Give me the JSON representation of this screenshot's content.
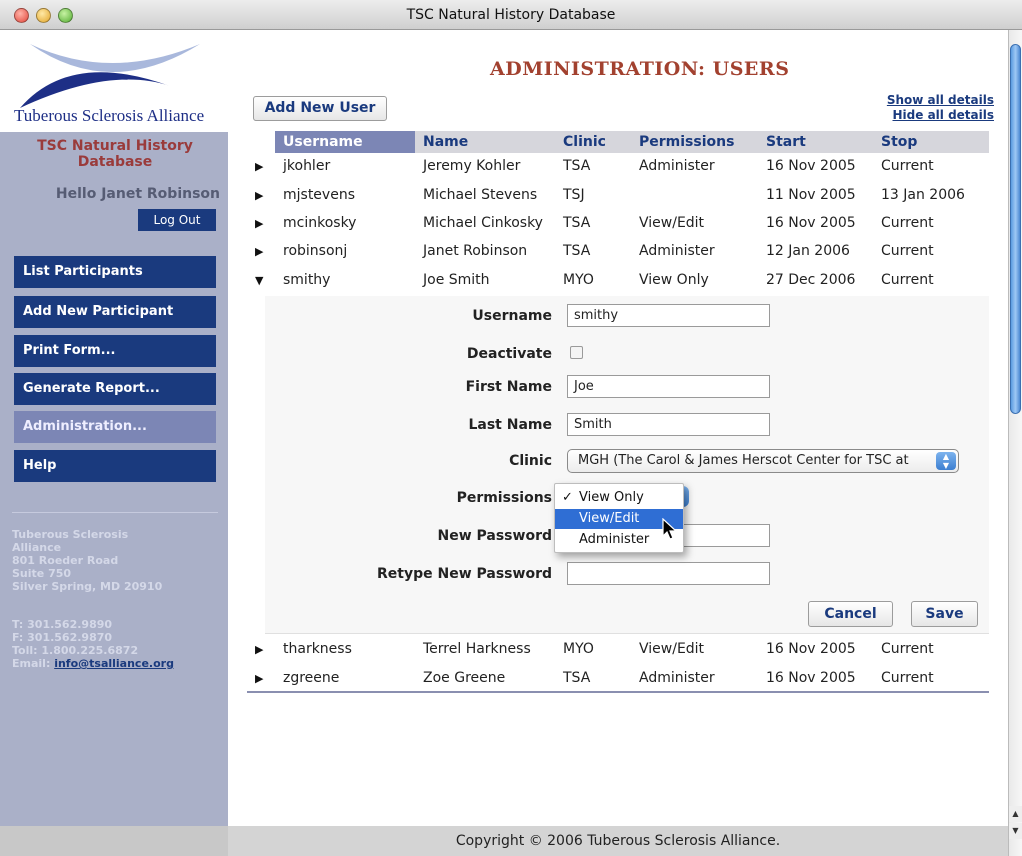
{
  "window": {
    "title": "TSC Natural History Database"
  },
  "sidebar": {
    "logo_text": "Tuberous Sclerosis Alliance",
    "db_title": "TSC Natural History Database",
    "greeting": "Hello Janet Robinson",
    "logout": "Log Out",
    "nav": [
      {
        "label": "List Participants"
      },
      {
        "label": "Add New Participant"
      },
      {
        "label": "Print Form..."
      },
      {
        "label": "Generate Report..."
      },
      {
        "label": "Administration...",
        "active": true
      },
      {
        "label": "Help"
      }
    ],
    "address": [
      "Tuberous Sclerosis",
      "Alliance",
      "801 Roeder Road",
      "Suite 750",
      "Silver Spring, MD 20910"
    ],
    "phone": "T: 301.562.9890",
    "fax": "F: 301.562.9870",
    "tollfree": "Toll: 1.800.225.6872",
    "email_label": "Email:",
    "email": "info@tsalliance.org"
  },
  "page": {
    "title": "Administration: Users",
    "add_user": "Add New User",
    "show_all": "Show all details",
    "hide_all": "Hide all details"
  },
  "table": {
    "headers": [
      "Username",
      "Name",
      "Clinic",
      "Permissions",
      "Start",
      "Stop"
    ],
    "rows": [
      [
        "jkohler",
        "Jeremy Kohler",
        "TSA",
        "Administer",
        "16 Nov 2005",
        "Current"
      ],
      [
        "mjstevens",
        "Michael Stevens",
        "TSJ",
        "",
        "11 Nov 2005",
        "13 Jan 2006"
      ],
      [
        "mcinkosky",
        "Michael Cinkosky",
        "TSA",
        "View/Edit",
        "16 Nov 2005",
        "Current"
      ],
      [
        "robinsonj",
        "Janet Robinson",
        "TSA",
        "Administer",
        "12 Jan 2006",
        "Current"
      ],
      [
        "smithy",
        "Joe Smith",
        "MYO",
        "View Only",
        "27 Dec 2006",
        "Current"
      ],
      [
        "tharkness",
        "Terrel Harkness",
        "MYO",
        "View/Edit",
        "16 Nov 2005",
        "Current"
      ],
      [
        "zgreene",
        "Zoe Greene",
        "TSA",
        "Administer",
        "16 Nov 2005",
        "Current"
      ]
    ]
  },
  "form": {
    "username_label": "Username",
    "username": "smithy",
    "deactivate_label": "Deactivate",
    "first_label": "First Name",
    "first": "Joe",
    "last_label": "Last Name",
    "last": "Smith",
    "clinic_label": "Clinic",
    "clinic": "MGH (The Carol & James Herscot Center for TSC at",
    "permissions_label": "Permissions",
    "permission_options": [
      "View Only",
      "View/Edit",
      "Administer"
    ],
    "permission_selected": "View Only",
    "permission_highlighted": "View/Edit",
    "newpw_label": "New Password",
    "retype_label": "Retype New Password",
    "cancel": "Cancel",
    "save": "Save"
  },
  "footer": {
    "copyright": "Copyright © 2006 Tuberous Sclerosis Alliance."
  },
  "colors": {
    "nav_blue": "#1a3a7e",
    "title_red": "#a2412f",
    "sidebar_bg": "#aab0c8"
  }
}
